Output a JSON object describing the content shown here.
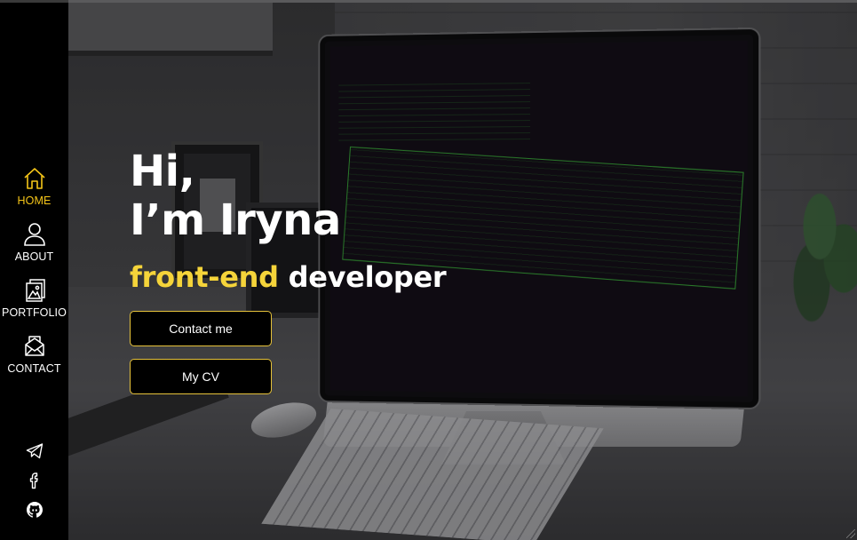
{
  "sidebar": {
    "nav": [
      {
        "label": "HOME",
        "icon": "home-icon",
        "active": true
      },
      {
        "label": "ABOUT",
        "icon": "user-icon",
        "active": false
      },
      {
        "label": "PORTFOLIO",
        "icon": "portfolio-icon",
        "active": false
      },
      {
        "label": "CONTACT",
        "icon": "contact-icon",
        "active": false
      }
    ],
    "social": [
      {
        "icon": "telegram-icon"
      },
      {
        "icon": "facebook-icon"
      },
      {
        "icon": "github-icon"
      }
    ]
  },
  "hero": {
    "greeting_line1": "Hi,",
    "greeting_line2": "I’m Iryna",
    "role_accent": "front-end",
    "role_rest": "developer",
    "contact_button": "Contact me",
    "cv_button": "My CV"
  },
  "colors": {
    "accent": "#f5c518",
    "role_accent": "#f5d43a",
    "button_border": "#e6c23a",
    "sidebar_bg": "#000000"
  }
}
